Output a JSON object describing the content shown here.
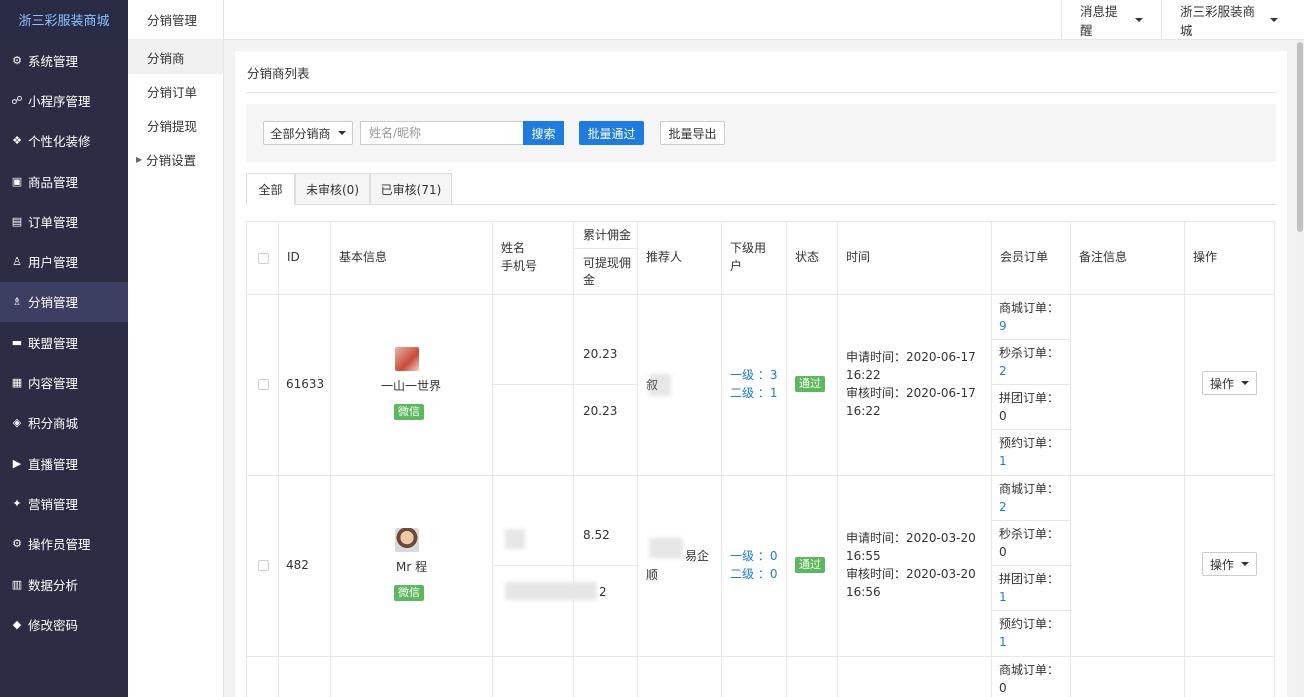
{
  "brand": "浙三彩服装商城",
  "sidebar": {
    "items": [
      {
        "icon": "⚙",
        "label": "系统管理"
      },
      {
        "icon": "☍",
        "label": "小程序管理"
      },
      {
        "icon": "❖",
        "label": "个性化装修"
      },
      {
        "icon": "▣",
        "label": "商品管理"
      },
      {
        "icon": "▤",
        "label": "订单管理"
      },
      {
        "icon": "♙",
        "label": "用户管理"
      },
      {
        "icon": "♗",
        "label": "分销管理"
      },
      {
        "icon": "▬",
        "label": "联盟管理"
      },
      {
        "icon": "▦",
        "label": "内容管理"
      },
      {
        "icon": "◈",
        "label": "积分商城"
      },
      {
        "icon": "▶",
        "label": "直播管理"
      },
      {
        "icon": "✦",
        "label": "营销管理"
      },
      {
        "icon": "⚙",
        "label": "操作员管理"
      },
      {
        "icon": "▥",
        "label": "数据分析"
      },
      {
        "icon": "◆",
        "label": "修改密码"
      }
    ]
  },
  "submenu": {
    "title": "分销管理",
    "items": [
      "分销商",
      "分销订单",
      "分销提现",
      "分销设置"
    ]
  },
  "topbar": {
    "notify": "消息提醒",
    "store": "浙三彩服装商城"
  },
  "page": {
    "title": "分销商列表",
    "filter": {
      "dropdown": "全部分销商",
      "search_placeholder": "姓名/昵称",
      "search": "搜索",
      "batch_pass": "批量通过",
      "batch_export": "批量导出"
    },
    "tabs": [
      "全部",
      "未审核(0)",
      "已审核(71)"
    ]
  },
  "table": {
    "headers": {
      "id": "ID",
      "basic": "基本信息",
      "name_l1": "姓名",
      "name_l2": "手机号",
      "comm_total": "累计佣金",
      "comm_avail_l1": "可提现佣",
      "comm_avail_l2": "金",
      "referrer": "推荐人",
      "sub_l1": "下级用",
      "sub_l2": "户",
      "status": "状态",
      "time": "时间",
      "orders": "会员订单",
      "remark": "备注信息",
      "ops": "操作"
    },
    "order_labels": [
      "商城订单：",
      "秒杀订单：",
      "拼团订单：",
      "预约订单："
    ],
    "rows": [
      {
        "id": "61633",
        "nickname": "一山一世界",
        "source": "微信",
        "comm_total": "20.23",
        "comm_avail": "20.23",
        "referrer": "叙",
        "level1": "一级 ：3",
        "level2": "二级 ：1",
        "status": "通过",
        "apply_time_l1": "申请时间：2020-06-17",
        "apply_time_l2": "16:22",
        "audit_time_l1": "审核时间：2020-06-17",
        "audit_time_l2": "16:22",
        "orders": [
          "9",
          "2",
          "0",
          "1"
        ],
        "op": "操作"
      },
      {
        "id": "482",
        "nickname": "Mr 程",
        "source": "微信",
        "comm_total": "8.52",
        "comm_avail": "2",
        "referrer_l1": "易企",
        "referrer_l2": "顺",
        "level1": "一级 ：0",
        "level2": "二级 ：0",
        "status": "通过",
        "apply_time_l1": "申请时间：2020-03-20",
        "apply_time_l2": "16:55",
        "audit_time_l1": "审核时间：2020-03-20",
        "audit_time_l2": "16:56",
        "orders": [
          "2",
          "0",
          "1",
          "1"
        ],
        "op": "操作"
      },
      {
        "orders": [
          "0"
        ]
      }
    ]
  },
  "colors": {
    "sidebar_bg": "#2c2d44",
    "brand_text": "#8cc3ff",
    "primary": "#1e7be0",
    "success": "#5cb85c"
  }
}
